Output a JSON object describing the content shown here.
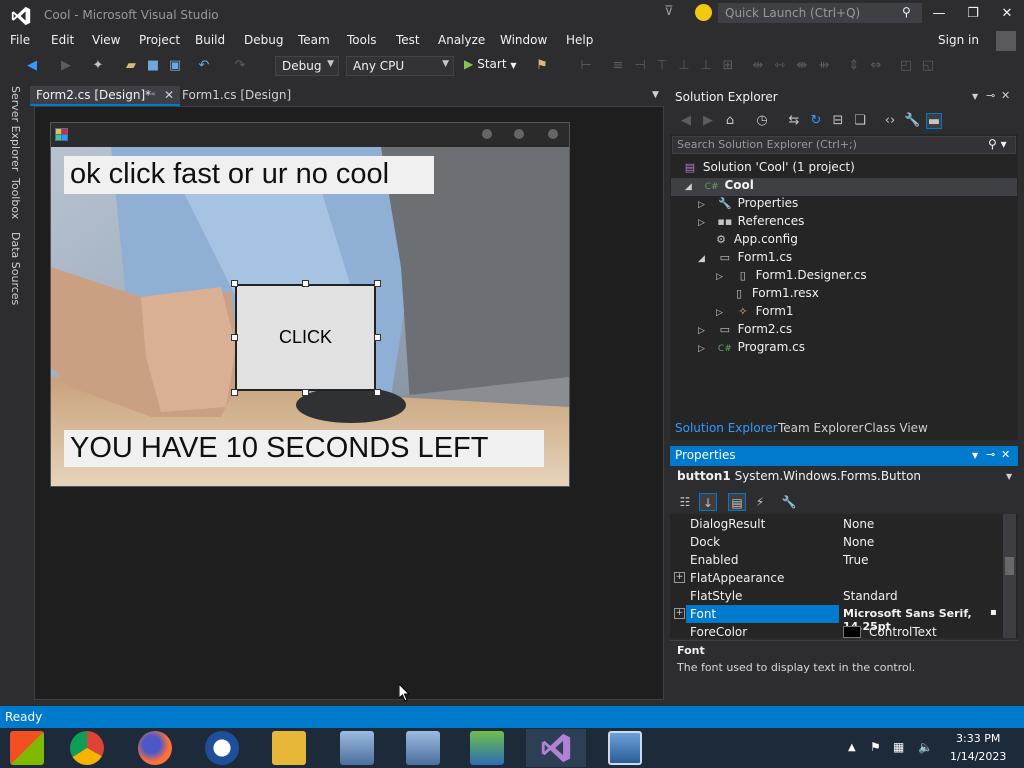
{
  "window": {
    "title": "Cool - Microsoft Visual Studio",
    "quick_launch_placeholder": "Quick Launch (Ctrl+Q)",
    "sign_in": "Sign in"
  },
  "menu": [
    "File",
    "Edit",
    "View",
    "Project",
    "Build",
    "Debug",
    "Team",
    "Tools",
    "Test",
    "Analyze",
    "Window",
    "Help"
  ],
  "toolbar": {
    "config": "Debug",
    "platform": "Any CPU",
    "start": "Start"
  },
  "side_tabs": [
    "Server Explorer",
    "Toolbox",
    "Data Sources"
  ],
  "doc_tabs": {
    "active": "Form2.cs [Design]*",
    "inactive": "Form1.cs [Design]"
  },
  "designer": {
    "label_top": "ok click fast or ur no cool",
    "button_text": "CLICK",
    "label_bottom": "YOU HAVE 10 SECONDS LEFT"
  },
  "solution_explorer": {
    "title": "Solution Explorer",
    "search_placeholder": "Search Solution Explorer (Ctrl+;)",
    "tree": [
      {
        "label": "Solution 'Cool' (1 project)",
        "icon": "solution-icon"
      },
      {
        "label": "Cool",
        "icon": "csharp-project-icon"
      },
      {
        "label": "Properties",
        "icon": "wrench-icon"
      },
      {
        "label": "References",
        "icon": "references-icon"
      },
      {
        "label": "App.config",
        "icon": "config-file-icon"
      },
      {
        "label": "Form1.cs",
        "icon": "form-file-icon"
      },
      {
        "label": "Form1.Designer.cs",
        "icon": "cs-file-icon"
      },
      {
        "label": "Form1.resx",
        "icon": "resx-file-icon"
      },
      {
        "label": "Form1",
        "icon": "class-icon"
      },
      {
        "label": "Form2.cs",
        "icon": "form-file-icon"
      },
      {
        "label": "Program.cs",
        "icon": "cs-file-icon"
      }
    ],
    "tabs": [
      "Solution Explorer",
      "Team Explorer",
      "Class View"
    ]
  },
  "properties": {
    "title": "Properties",
    "object_name": "button1",
    "object_type": "System.Windows.Forms.Button",
    "rows": [
      {
        "name": "DialogResult",
        "value": "None"
      },
      {
        "name": "Dock",
        "value": "None"
      },
      {
        "name": "Enabled",
        "value": "True"
      },
      {
        "name": "FlatAppearance",
        "value": ""
      },
      {
        "name": "FlatStyle",
        "value": "Standard"
      },
      {
        "name": "Font",
        "value": "Microsoft Sans Serif, 14.25pt"
      },
      {
        "name": "ForeColor",
        "value": "ControlText"
      }
    ],
    "desc_title": "Font",
    "desc_text": "The font used to display text in the control."
  },
  "status": {
    "text": "Ready"
  },
  "taskbar": {
    "time": "3:33 PM",
    "date": "1/14/2023"
  },
  "colors": {
    "accent": "#007acc",
    "background": "#2d2d30",
    "taskbar": "#1c2a3a"
  }
}
